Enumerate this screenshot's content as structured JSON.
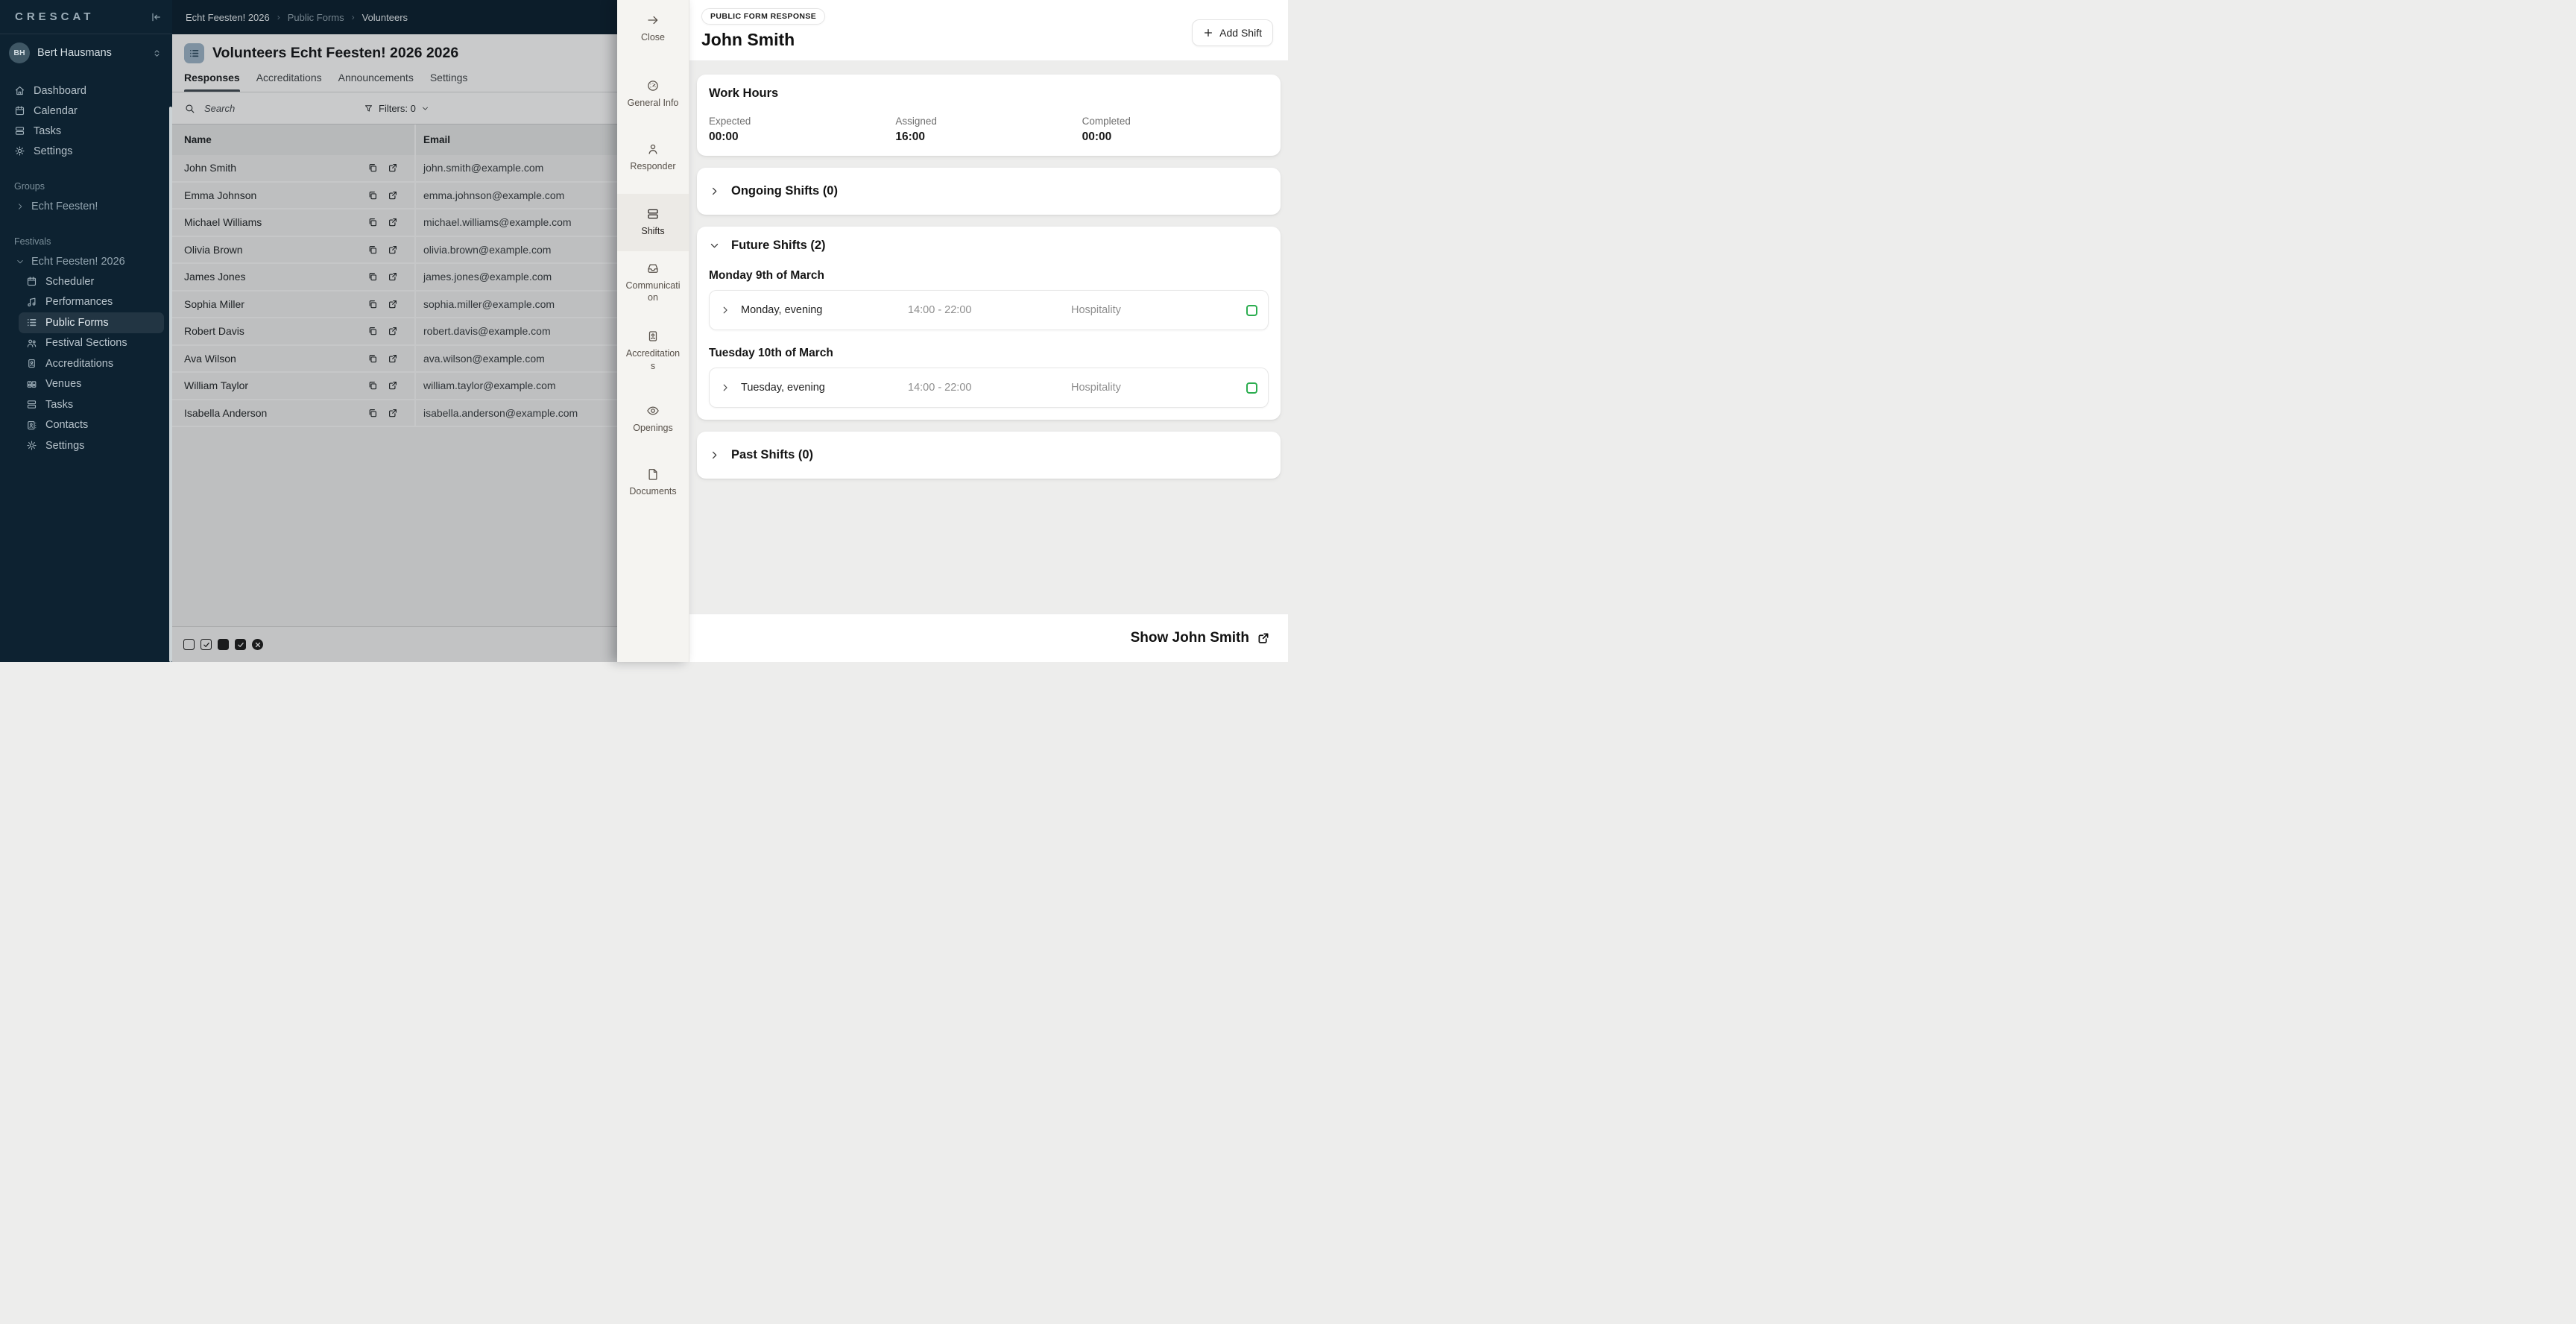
{
  "colors": {
    "navy": "#0d2231",
    "accent_green": "#2bad4f"
  },
  "sidebar": {
    "logo": "CRESCAT",
    "user": {
      "initials": "BH",
      "name": "Bert Hausmans"
    },
    "nav": [
      {
        "label": "Dashboard",
        "icon": "home-icon"
      },
      {
        "label": "Calendar",
        "icon": "calendar-icon"
      },
      {
        "label": "Tasks",
        "icon": "tasks-icon"
      },
      {
        "label": "Settings",
        "icon": "gear-icon"
      }
    ],
    "groups_label": "Groups",
    "group_item": "Echt Feesten!",
    "festivals_label": "Festivals",
    "festival_parent": "Echt Feesten! 2026",
    "festival_items": [
      {
        "label": "Scheduler",
        "icon": "calendar-icon",
        "active": false
      },
      {
        "label": "Performances",
        "icon": "music-icon",
        "active": false
      },
      {
        "label": "Public Forms",
        "icon": "list-icon",
        "active": true
      },
      {
        "label": "Festival Sections",
        "icon": "users-icon",
        "active": false
      },
      {
        "label": "Accreditations",
        "icon": "id-card-icon",
        "active": false
      },
      {
        "label": "Venues",
        "icon": "speakers-icon",
        "active": false
      },
      {
        "label": "Tasks",
        "icon": "tasks-icon",
        "active": false
      },
      {
        "label": "Contacts",
        "icon": "contact-card-icon",
        "active": false
      },
      {
        "label": "Settings",
        "icon": "gear-icon",
        "active": false
      }
    ]
  },
  "breadcrumb": {
    "items": [
      "Echt Feesten! 2026",
      "Public Forms",
      "Volunteers"
    ]
  },
  "list_panel": {
    "title": "Volunteers Echt Feesten! 2026 2026",
    "tabs": [
      {
        "label": "Responses",
        "active": true
      },
      {
        "label": "Accreditations",
        "active": false
      },
      {
        "label": "Announcements",
        "active": false
      },
      {
        "label": "Settings",
        "active": false
      }
    ],
    "search_placeholder": "Search",
    "filters_label": "Filters: 0",
    "columns": [
      "Name",
      "Email"
    ],
    "rows": [
      {
        "name": "John Smith",
        "email": "john.smith@example.com"
      },
      {
        "name": "Emma Johnson",
        "email": "emma.johnson@example.com"
      },
      {
        "name": "Michael Williams",
        "email": "michael.williams@example.com"
      },
      {
        "name": "Olivia Brown",
        "email": "olivia.brown@example.com"
      },
      {
        "name": "James Jones",
        "email": "james.jones@example.com"
      },
      {
        "name": "Sophia Miller",
        "email": "sophia.miller@example.com"
      },
      {
        "name": "Robert Davis",
        "email": "robert.davis@example.com"
      },
      {
        "name": "Ava Wilson",
        "email": "ava.wilson@example.com"
      },
      {
        "name": "William Taylor",
        "email": "william.taylor@example.com"
      },
      {
        "name": "Isabella Anderson",
        "email": "isabella.anderson@example.com"
      }
    ],
    "status_icons": [
      "empty-checkbox",
      "checked-checkbox-outline",
      "filled-square",
      "filled-square-check",
      "filled-circle-x"
    ]
  },
  "drawer": {
    "nav": [
      {
        "label": "Close",
        "icon": "arrow-right-icon",
        "active": false
      },
      {
        "label": "General Info",
        "icon": "gauge-icon",
        "active": false
      },
      {
        "label": "Responder",
        "icon": "person-icon",
        "active": false
      },
      {
        "label": "Shifts",
        "icon": "shifts-icon",
        "active": true
      },
      {
        "label": "Communication",
        "icon": "inbox-icon",
        "active": false
      },
      {
        "label": "Accreditations",
        "icon": "id-card-icon",
        "active": false
      },
      {
        "label": "Openings",
        "icon": "eye-icon",
        "active": false
      },
      {
        "label": "Documents",
        "icon": "document-icon",
        "active": false
      }
    ],
    "badge": "PUBLIC FORM RESPONSE",
    "title": "John Smith",
    "add_shift_label": "Add Shift",
    "work_hours": {
      "title": "Work Hours",
      "stats": [
        {
          "label": "Expected",
          "value": "00:00"
        },
        {
          "label": "Assigned",
          "value": "16:00"
        },
        {
          "label": "Completed",
          "value": "00:00"
        }
      ]
    },
    "ongoing_title": "Ongoing Shifts (0)",
    "future_title": "Future Shifts (2)",
    "past_title": "Past Shifts (0)",
    "future_groups": [
      {
        "date": "Monday 9th of March",
        "shift": {
          "title": "Monday, evening",
          "time": "14:00 - 22:00",
          "section": "Hospitality"
        }
      },
      {
        "date": "Tuesday 10th of March",
        "shift": {
          "title": "Tuesday, evening",
          "time": "14:00 - 22:00",
          "section": "Hospitality"
        }
      }
    ],
    "footer_link": "Show John Smith"
  }
}
